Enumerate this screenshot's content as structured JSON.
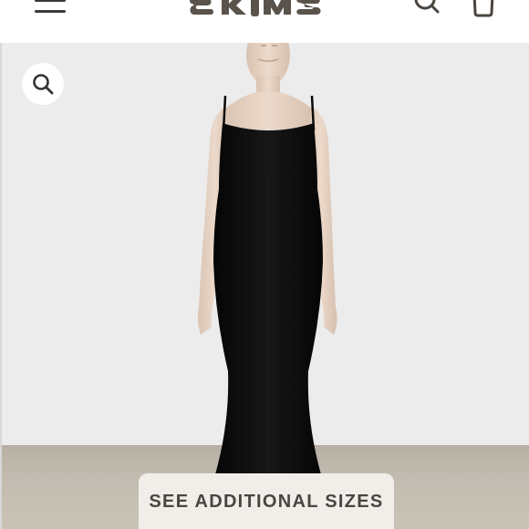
{
  "header": {
    "menu_icon": "hamburger-menu-icon",
    "brand_name": "SKIMS",
    "search_icon": "search-icon",
    "bag_icon": "shopping-bag-icon"
  },
  "product_gallery": {
    "zoom_icon": "magnifier-icon",
    "cta_label": "SEE ADDITIONAL SIZES",
    "background_color": "#ececec",
    "floor_color": "#c3bcb1",
    "garment_color": "#0d0d0d"
  }
}
